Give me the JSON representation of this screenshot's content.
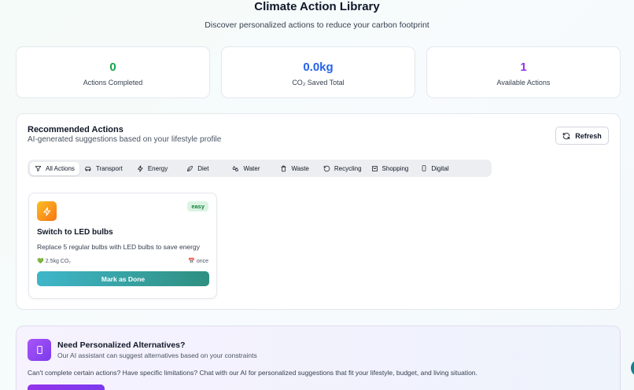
{
  "header": {
    "title": "Climate Action Library",
    "subtitle": "Discover personalized actions to reduce your carbon footprint"
  },
  "stats": [
    {
      "value": "0",
      "label": "Actions Completed",
      "color": "#16a34a"
    },
    {
      "value": "0.0kg",
      "label": "CO₂ Saved Total",
      "color": "#2563eb"
    },
    {
      "value": "1",
      "label": "Available Actions",
      "color": "#9333ea"
    }
  ],
  "recommended": {
    "title": "Recommended Actions",
    "subtitle": "AI-generated suggestions based on your lifestyle profile",
    "refresh_label": "Refresh",
    "filters": [
      {
        "label": "All Actions",
        "icon": "filter-icon",
        "active": true
      },
      {
        "label": "Transport",
        "icon": "car-icon"
      },
      {
        "label": "Energy",
        "icon": "lightning-icon"
      },
      {
        "label": "Diet",
        "icon": "leaf-icon"
      },
      {
        "label": "Water",
        "icon": "droplets-icon"
      },
      {
        "label": "Waste",
        "icon": "trash-icon"
      },
      {
        "label": "Recycling",
        "icon": "rotate-icon"
      },
      {
        "label": "Shopping",
        "icon": "shopping-bag-icon"
      },
      {
        "label": "Digital",
        "icon": "smartphone-icon"
      }
    ],
    "action": {
      "badge": "easy",
      "title": "Switch to LED bulbs",
      "description": "Replace 5 regular bulbs with LED bulbs to save energy",
      "co2": "2.5kg CO₂",
      "co2_icon": "💚",
      "frequency": "once",
      "frequency_icon": "📅",
      "button_label": "Mark as Done"
    }
  },
  "ai": {
    "title": "Need Personalized Alternatives?",
    "subtitle": "Our AI assistant can suggest alternatives based on your constraints",
    "description": "Can't complete certain actions? Have specific limitations? Chat with our AI for personalized suggestions that fit your lifestyle, budget, and living situation."
  }
}
